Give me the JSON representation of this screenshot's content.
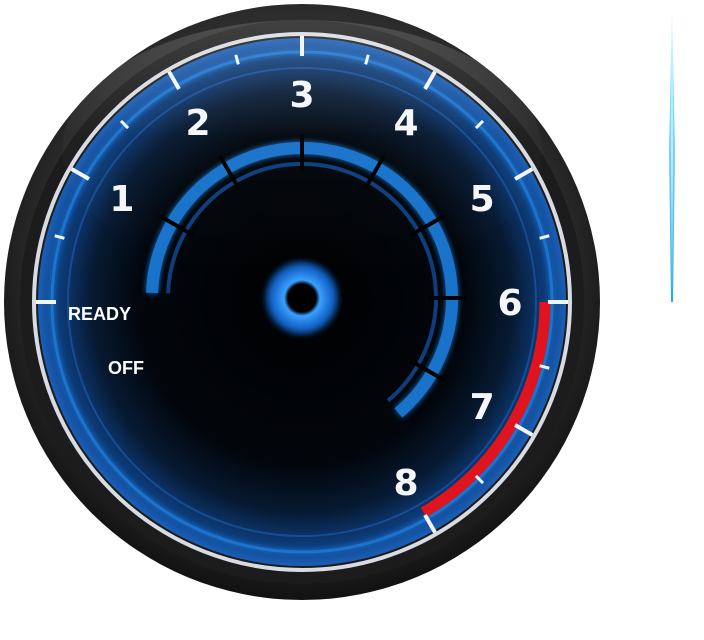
{
  "gauge": {
    "type": "tachometer",
    "dial_labels": [
      "1",
      "2",
      "3",
      "4",
      "5",
      "6",
      "7",
      "8"
    ],
    "redline_start": 6,
    "range": [
      0,
      8
    ],
    "status": {
      "ready_label": "READY",
      "off_label": "OFF"
    },
    "colors": {
      "accent": "#1e7fe0",
      "accent_glow": "#5ab4ff",
      "redline": "#e0141e",
      "bezel": "#2a2a2a",
      "face": "#000000",
      "label": "#f4f6fa"
    }
  },
  "needle": {
    "icon": "needle-icon",
    "color": "#4fc3f7"
  }
}
